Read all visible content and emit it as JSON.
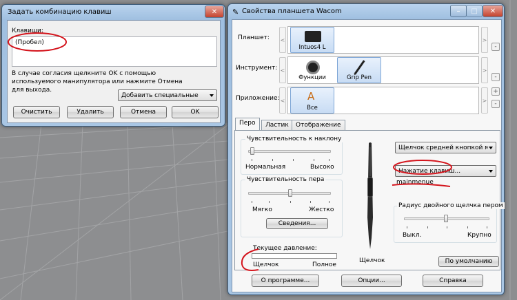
{
  "shortcut_dialog": {
    "title": "Задать комбинацию клавиш",
    "keys_label": "Клавиши:",
    "keys_value": "(Пробел)",
    "hint": "В случае согласия щелкните OK с помощью используемого манипулятора или нажмите Отмена для выхода.",
    "add_special": "Добавить специальные",
    "buttons": {
      "clear": "Очистить",
      "delete": "Удалить",
      "cancel": "Отмена",
      "ok": "OK"
    }
  },
  "wacom": {
    "title": "Свойства планшета Wacom",
    "row_tablet": "Планшет:",
    "row_tool": "Инструмент:",
    "row_app": "Приложение:",
    "tablet_name": "Intuos4 L",
    "tool_functions": "Функции",
    "tool_pen": "Grip Pen",
    "app_all": "Все",
    "tabs": [
      "Перо",
      "Ластик",
      "Отображение"
    ],
    "tilt": {
      "title": "Чувствительность к наклону",
      "low": "Нормальная",
      "high": "Высоко",
      "level": 0.0
    },
    "pen_feel": {
      "title": "Чувствительность пера",
      "low": "Мягко",
      "high": "Жестко",
      "level": 0.5,
      "details": "Сведения..."
    },
    "pressure": {
      "title": "Текущее давление:",
      "low": "Щелчок",
      "high": "Полное"
    },
    "middle_button": "Щелчок средней кнопкой мы",
    "keystroke": "Нажатие клавиш...",
    "keystroke_name": "mainmenue",
    "dbl_click": {
      "title": "Радиус двойного щелчка пером",
      "low": "Выкл.",
      "high": "Крупно",
      "level": 0.5
    },
    "tip_label": "Щелчок",
    "defaults": "По умолчанию",
    "about": "О программе...",
    "options": "Опции...",
    "help": "Справка",
    "plus": "+",
    "minus": "-",
    "scroll_left": "<",
    "scroll_right": ">"
  },
  "colors": {
    "annotation": "#d4141c",
    "selected_tile": "#c8dcf4",
    "window_frame": "#a9c6e4"
  }
}
